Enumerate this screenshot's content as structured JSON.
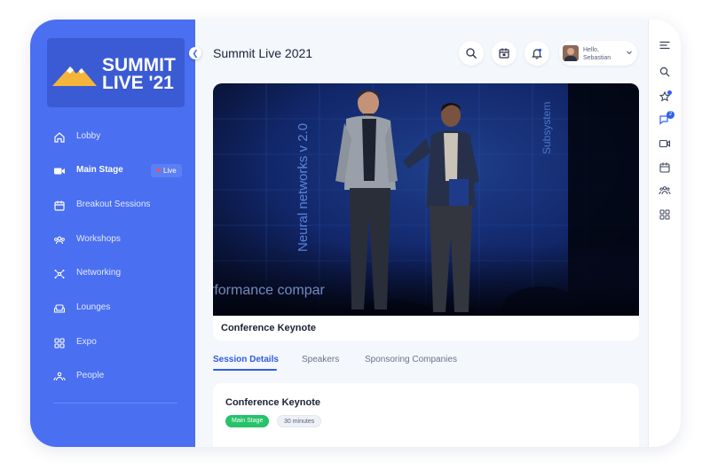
{
  "brand": {
    "logo_line1": "SUMMIT",
    "logo_line2": "LIVE '21"
  },
  "sidebar": {
    "items": [
      {
        "label": "Lobby",
        "icon": "home-icon"
      },
      {
        "label": "Main Stage",
        "icon": "video-camera-icon",
        "active": true,
        "badge": "Live"
      },
      {
        "label": "Breakout Sessions",
        "icon": "calendar-icon"
      },
      {
        "label": "Workshops",
        "icon": "group-icon"
      },
      {
        "label": "Networking",
        "icon": "network-icon"
      },
      {
        "label": "Lounges",
        "icon": "couch-icon"
      },
      {
        "label": "Expo",
        "icon": "grid-icon"
      },
      {
        "label": "People",
        "icon": "people-icon"
      }
    ]
  },
  "header": {
    "title": "Summit Live 2021",
    "user": {
      "greeting": "Hello,",
      "name": "Sebastian"
    }
  },
  "video": {
    "caption": "Conference Keynote",
    "screen_text_1": "Neural networks v 2.0",
    "screen_text_2": "Subsystem",
    "screen_text_3": "rformance compar"
  },
  "tabs": [
    {
      "label": "Session Details",
      "active": true
    },
    {
      "label": "Speakers"
    },
    {
      "label": "Sponsoring Companies"
    }
  ],
  "details": {
    "title": "Conference Keynote",
    "stage_tag": "Main Stage",
    "duration_tag": "30 minutes"
  },
  "rail": {
    "badge_count": "2"
  },
  "colors": {
    "sidebar": "#4a6ff0",
    "accent": "#2f5ce0",
    "live_dot": "#ff4d4d",
    "stage_tag": "#27c26a"
  }
}
